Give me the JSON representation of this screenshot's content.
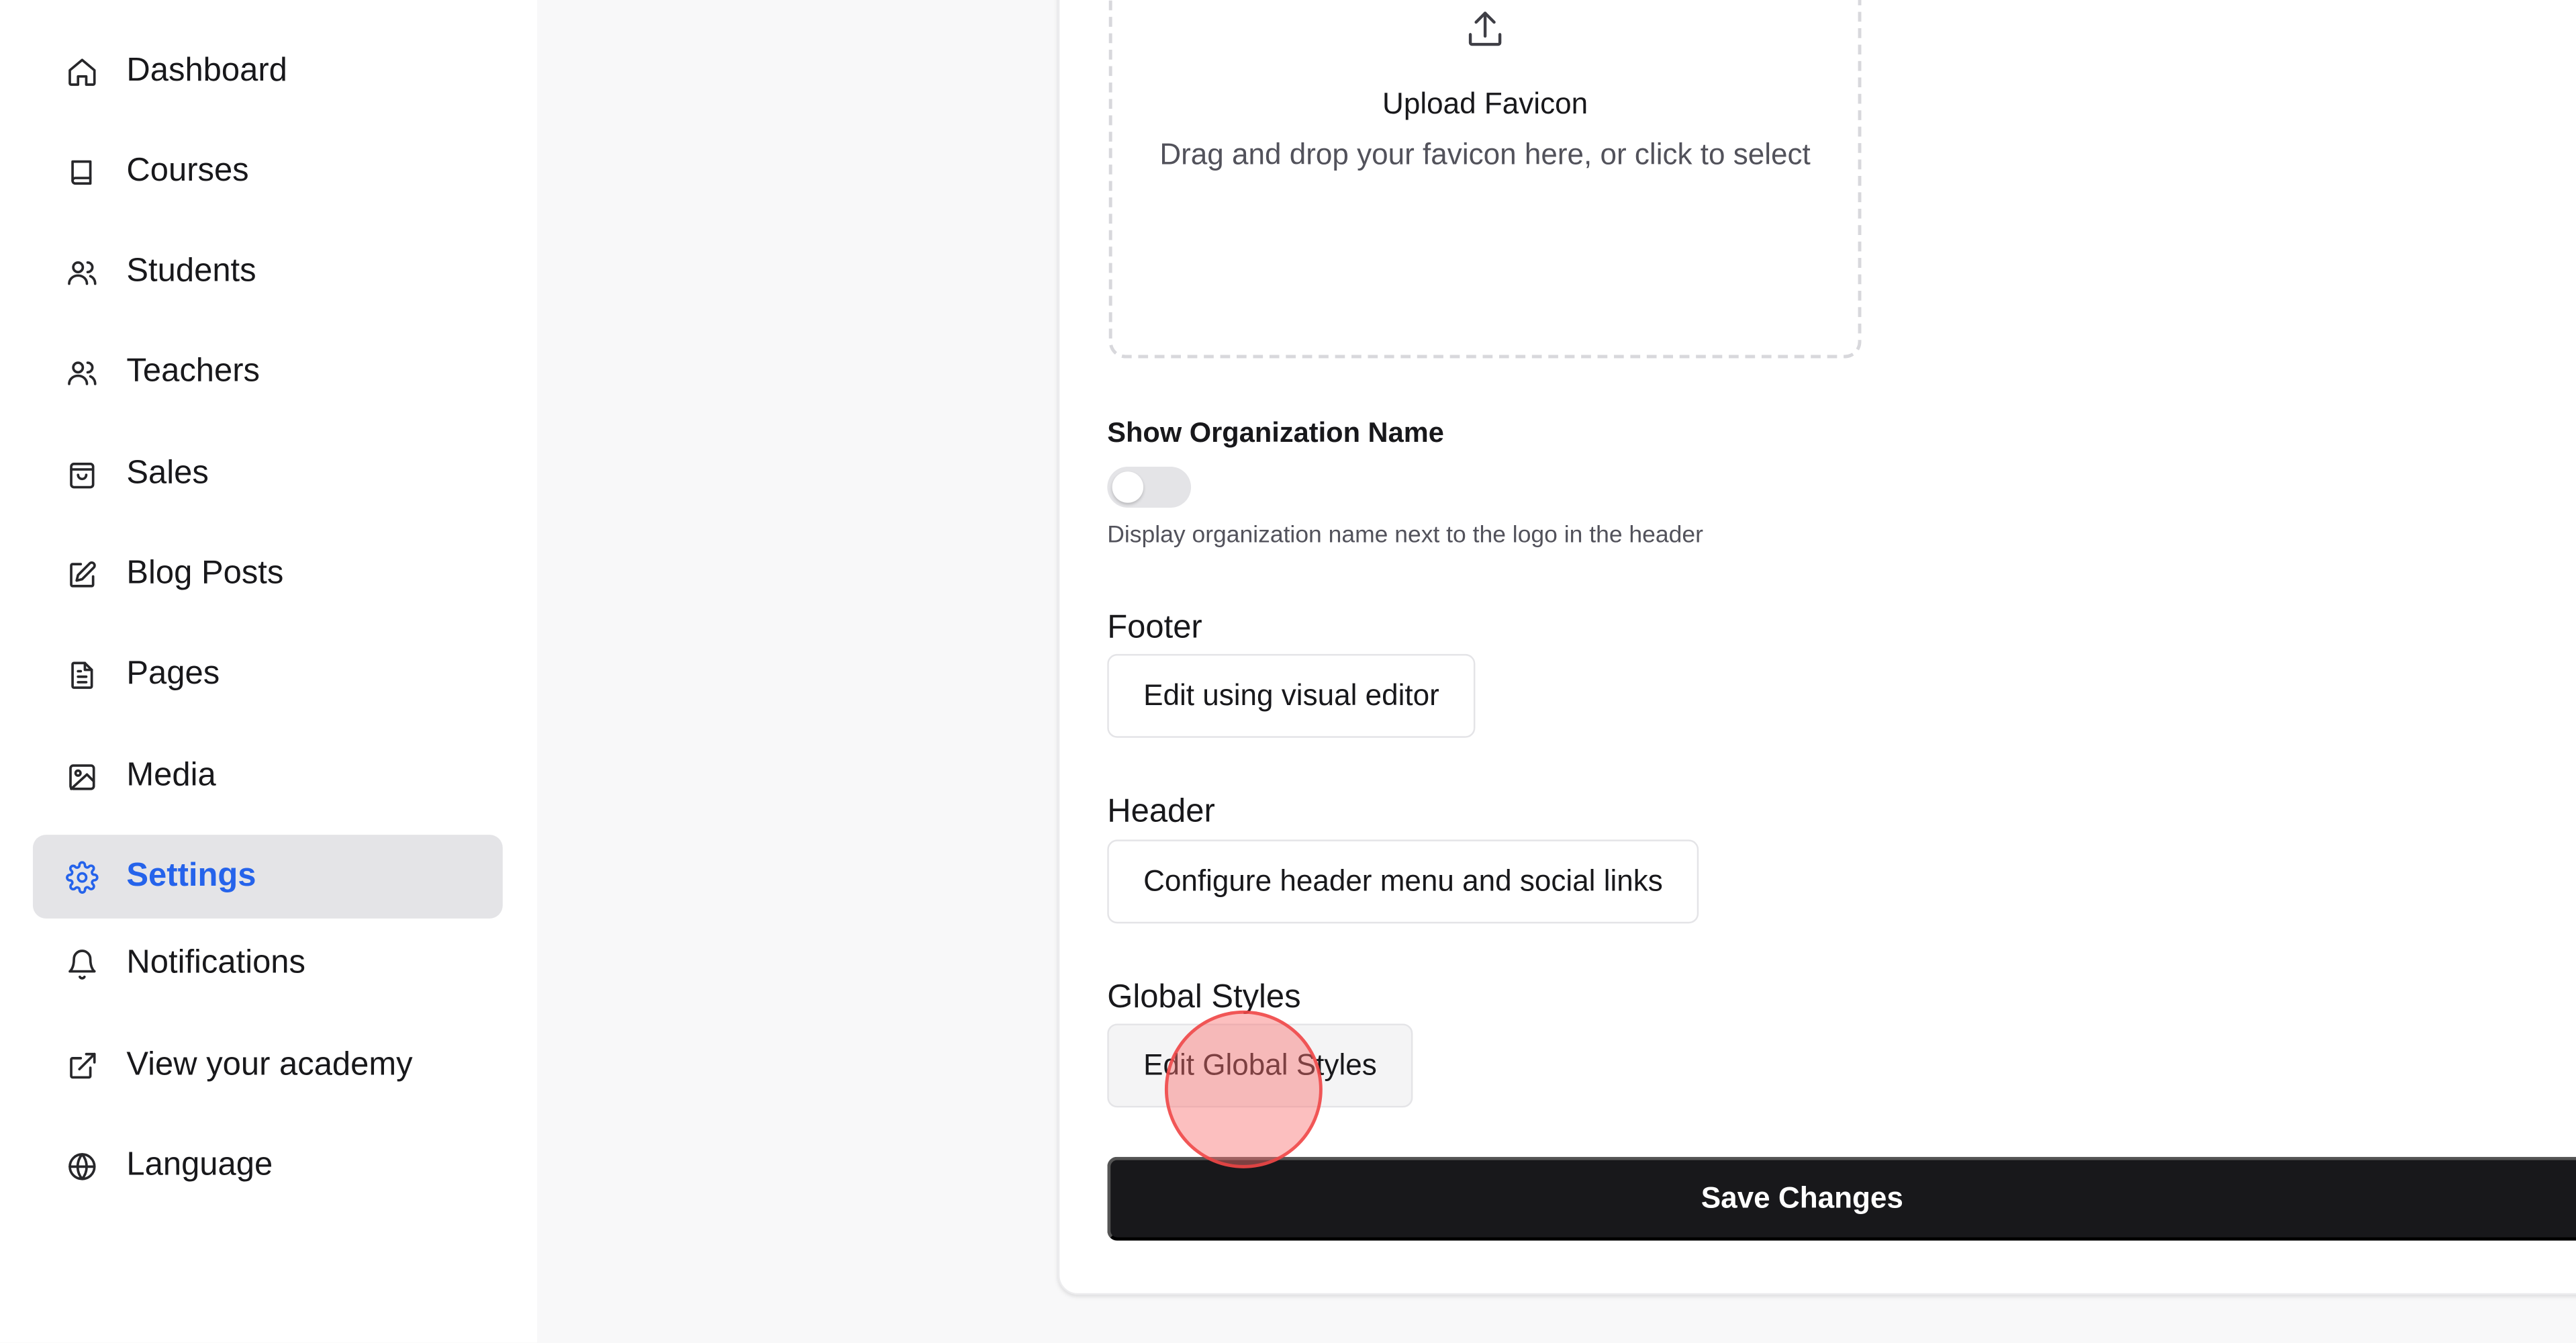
{
  "sidebar": {
    "items": [
      {
        "label": "Dashboard",
        "icon": "home-icon"
      },
      {
        "label": "Courses",
        "icon": "book-icon"
      },
      {
        "label": "Students",
        "icon": "users-icon"
      },
      {
        "label": "Teachers",
        "icon": "users-icon"
      },
      {
        "label": "Sales",
        "icon": "shopping-bag-icon"
      },
      {
        "label": "Blog Posts",
        "icon": "edit-icon"
      },
      {
        "label": "Pages",
        "icon": "file-text-icon"
      },
      {
        "label": "Media",
        "icon": "image-icon"
      },
      {
        "label": "Settings",
        "icon": "gear-icon",
        "active": true
      },
      {
        "label": "Notifications",
        "icon": "bell-icon"
      },
      {
        "label": "View your academy",
        "icon": "external-link-icon"
      },
      {
        "label": "Language",
        "icon": "globe-icon"
      }
    ]
  },
  "favicon_upload": {
    "title": "Upload Favicon",
    "subtitle": "Drag and drop your favicon here, or click to select",
    "icon": "upload-icon"
  },
  "org_name": {
    "label": "Show Organization Name",
    "enabled": false,
    "help": "Display organization name next to the logo in the header"
  },
  "footer": {
    "label": "Footer",
    "button": "Edit using visual editor"
  },
  "header": {
    "label": "Header",
    "button": "Configure header menu and social links"
  },
  "global_styles": {
    "label": "Global Styles",
    "button": "Edit Global Styles"
  },
  "save_button": "Save Changes",
  "colors": {
    "accent": "#2563eb",
    "primary_button": "#18181b",
    "active_nav_bg": "#e4e4e7"
  }
}
